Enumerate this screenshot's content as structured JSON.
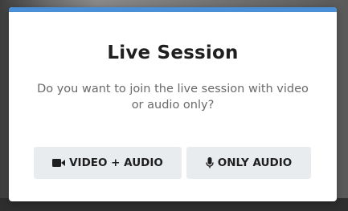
{
  "modal": {
    "title": "Live Session",
    "message": "Do you want to join the live session with video or audio only?",
    "accent_color": "#4a90d9",
    "buttons": {
      "video_audio_label": "VIDEO + AUDIO",
      "video_audio_icon": "video-camera-icon",
      "only_audio_label": "ONLY AUDIO",
      "only_audio_icon": "microphone-icon"
    }
  }
}
